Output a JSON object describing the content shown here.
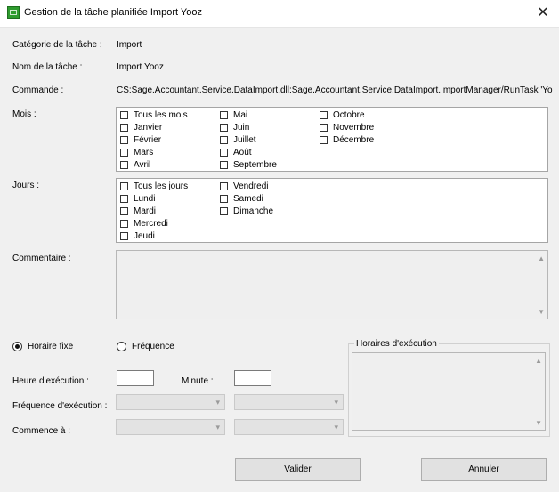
{
  "window": {
    "title": "Gestion de la tâche planifiée Import Yooz",
    "close_glyph": "✕"
  },
  "fields": {
    "category_label": "Catégorie de la tâche :",
    "category_value": "Import",
    "name_label": "Nom de la tâche :",
    "name_value": "Import Yooz",
    "command_label": "Commande :",
    "command_value": "CS:Sage.Accountant.Service.DataImport.dll:Sage.Accountant.Service.DataImport.ImportManager/RunTask 'Yo",
    "months_label": "Mois :",
    "days_label": "Jours :",
    "comment_label": "Commentaire :"
  },
  "months": [
    "Tous les mois",
    "Janvier",
    "Février",
    "Mars",
    "Avril",
    "Mai",
    "Juin",
    "Juillet",
    "Août",
    "Septembre",
    "Octobre",
    "Novembre",
    "Décembre"
  ],
  "days": [
    "Tous les jours",
    "Lundi",
    "Mardi",
    "Mercredi",
    "Jeudi",
    "Vendredi",
    "Samedi",
    "Dimanche"
  ],
  "schedule": {
    "radio_fixed": "Horaire fixe",
    "radio_frequency": "Fréquence",
    "selected": "Horaire fixe",
    "hour_label": "Heure d'exécution :",
    "minute_label": "Minute :",
    "frequency_label": "Fréquence d'exécution :",
    "start_label": "Commence à :",
    "hour_value": "",
    "minute_value": "",
    "exec_times_label": "Horaires d'exécution"
  },
  "buttons": {
    "validate": "Valider",
    "cancel": "Annuler"
  }
}
